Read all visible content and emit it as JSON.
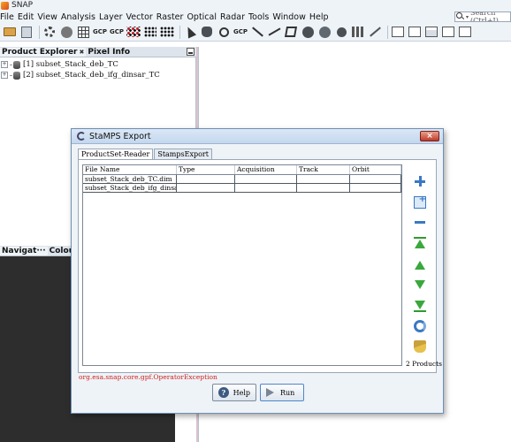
{
  "app": {
    "title": "SNAP"
  },
  "menu": [
    "File",
    "Edit",
    "View",
    "Analysis",
    "Layer",
    "Vector",
    "Raster",
    "Optical",
    "Radar",
    "Tools",
    "Window",
    "Help"
  ],
  "search": {
    "placeholder": "Search (Ctrl+I)"
  },
  "toolbar": {
    "icons": [
      "open-product-icon",
      "session-icon",
      "settings-icon",
      "graticule-icon",
      "gcp-manager-icon",
      "gcp-icon",
      "graph-builder-icon",
      "batch-graph-icon",
      "select-tool-icon",
      "pan-tool-icon",
      "zoom-tool-icon",
      "pin-placing-icon",
      "line-drawing-icon",
      "polygon-drawing-icon",
      "ellipse-drawing-icon",
      "range-finder-icon",
      "magic-wand-icon",
      "layout-icon"
    ],
    "gcp_label": "GCP"
  },
  "left_panel": {
    "tabs": [
      "Product Explorer",
      "Pixel Info"
    ],
    "products": [
      {
        "label": "[1] subset_Stack_deb_TC"
      },
      {
        "label": "[2] subset_Stack_deb_ifg_dinsar_TC"
      }
    ]
  },
  "bottom_panel": {
    "tabs": [
      "Navigat···",
      "Colour M"
    ]
  },
  "dialog": {
    "title": "StaMPS Export",
    "tabs": [
      "ProductSet-Reader",
      "StampsExport"
    ],
    "table": {
      "columns": [
        "File Name",
        "Type",
        "Acquisition",
        "Track",
        "Orbit"
      ],
      "rows": [
        [
          "subset_Stack_deb_TC.dim",
          "",
          "",
          "",
          ""
        ],
        [
          "subset_Stack_deb_ifg_dinsar_T...",
          "",
          "",
          "",
          ""
        ]
      ]
    },
    "side_actions": [
      "add-icon",
      "add-opened-icon",
      "remove-icon",
      "move-top-icon",
      "move-up-icon",
      "move-down-icon",
      "move-bottom-icon",
      "refresh-icon",
      "clear-icon"
    ],
    "product_count": "2 Products",
    "error": "org.esa.snap.core.gpf.OperatorException",
    "buttons": {
      "help": "Help",
      "run": "Run"
    },
    "close_symbol": "×",
    "help_symbol": "?"
  }
}
